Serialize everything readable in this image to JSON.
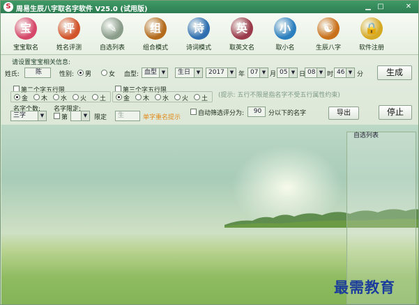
{
  "window": {
    "title": "周易生辰八字取名字软件 V25.0 (试用版)",
    "minimize": "▁",
    "close": "✕",
    "app_glyph": "S"
  },
  "toolbar": [
    {
      "label": "宝宝取名",
      "icon": "baby-icon",
      "glyph": "宝",
      "color": "#d6486a"
    },
    {
      "label": "姓名评测",
      "icon": "rating-icon",
      "glyph": "评",
      "color": "#d2542a"
    },
    {
      "label": "自选列表",
      "icon": "pencil-cup-icon",
      "glyph": "✎",
      "color": "#8a9c8a"
    },
    {
      "label": "组合模式",
      "icon": "lion-icon",
      "glyph": "组",
      "color": "#b46b1c"
    },
    {
      "label": "诗词模式",
      "icon": "book-icon",
      "glyph": "诗",
      "color": "#2f6fb0"
    },
    {
      "label": "取英文名",
      "icon": "barcelona-icon",
      "glyph": "英",
      "color": "#9a3a4a"
    },
    {
      "label": "取小名",
      "icon": "bird-icon",
      "glyph": "小",
      "color": "#2c7fbf"
    },
    {
      "label": "生辰八字",
      "icon": "bagua-icon",
      "glyph": "☯",
      "color": "#c9701a"
    },
    {
      "label": "软件注册",
      "icon": "lock-icon",
      "glyph": "🔒",
      "color": "#d6a924"
    }
  ],
  "section_label": "请设置宝宝相关信息:",
  "form": {
    "surname_label": "姓氏:",
    "surname_value": "陈",
    "gender_label": "性别:",
    "male": "男",
    "female": "女",
    "blood_label": "血型:",
    "blood_value": "血型",
    "birth_type": "生日",
    "year": "2017",
    "year_unit": "年",
    "month": "07",
    "month_unit": "月",
    "day": "05",
    "day_unit": "日",
    "hour": "08",
    "hour_unit": "时",
    "minute": "46",
    "minute_unit": "分",
    "generate": "生成"
  },
  "wuxing2": {
    "title": "第二个字五行限",
    "options": [
      "金",
      "木",
      "水",
      "火",
      "土"
    ]
  },
  "wuxing3": {
    "title": "第三个字五行限",
    "options": [
      "金",
      "木",
      "水",
      "火",
      "土"
    ]
  },
  "hint_text": "(提示: 五行不限是指名字不受五行属性约束)",
  "count": {
    "label": "名字个数:",
    "value": "三字"
  },
  "limit": {
    "label": "名字限定:",
    "di": "第",
    "xianding": "限定",
    "char_value": "生",
    "orange_note": "单字重名提示"
  },
  "auto": {
    "label": "自动筛选评分为:",
    "score": "90",
    "suffix": "分以下的名字"
  },
  "export": "导出",
  "stop": "停止",
  "list_title": "自选列表",
  "watermark": "最需教育"
}
